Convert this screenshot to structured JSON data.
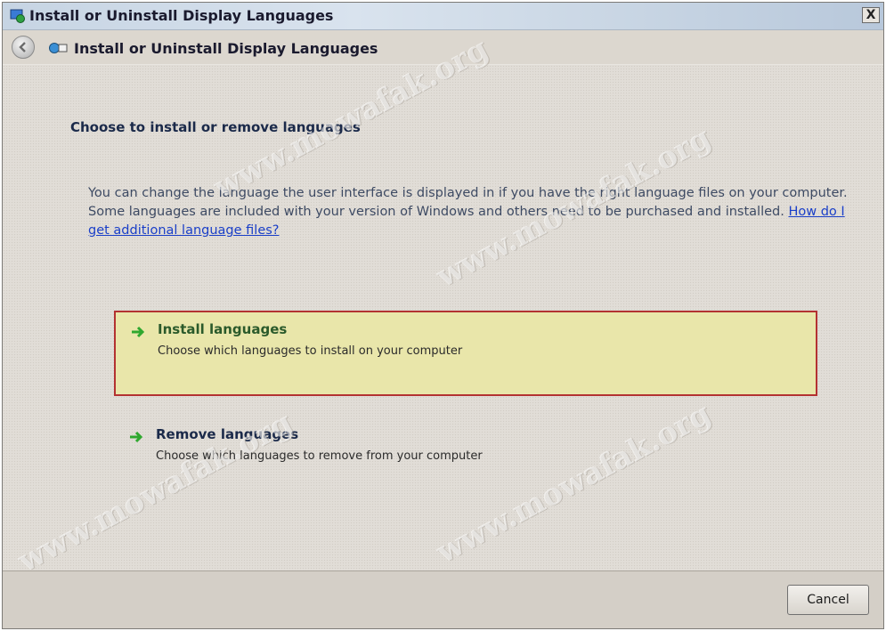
{
  "window": {
    "title": "Install or Uninstall Display Languages",
    "close_label": "X"
  },
  "navbar": {
    "title": "Install or Uninstall Display Languages"
  },
  "main": {
    "heading": "Choose to install or remove languages",
    "description": "You can change the language the user interface is displayed in if you have the right language files on your computer. Some languages are included with your version of Windows and others need to be purchased and installed.",
    "help_link": "How do I get additional language files?"
  },
  "options": [
    {
      "title": "Install languages",
      "description": "Choose which languages to install on your computer",
      "highlighted": true
    },
    {
      "title": "Remove languages",
      "description": "Choose which languages to remove from your computer",
      "highlighted": false
    }
  ],
  "footer": {
    "cancel_label": "Cancel"
  },
  "watermark": "www.mowafak.org",
  "colors": {
    "highlight_bg": "#e9e6aa",
    "highlight_border": "#b33232",
    "link": "#1a3fc8",
    "arrow": "#2fa82f"
  }
}
